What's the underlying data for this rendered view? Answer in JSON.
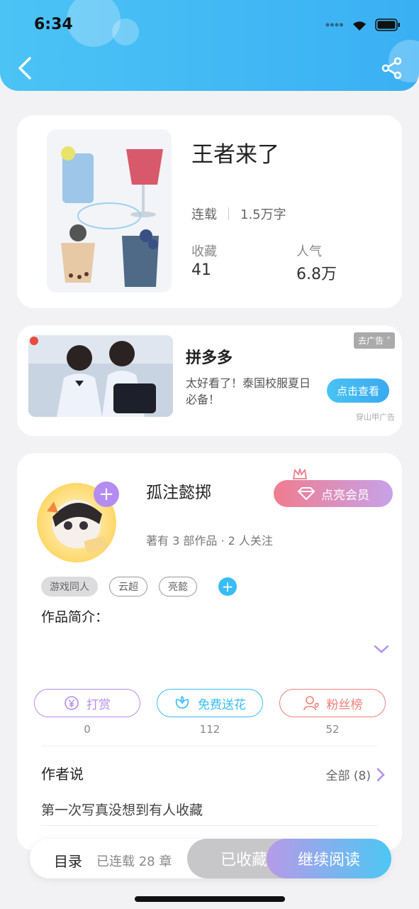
{
  "status_bar": {
    "time": "6:34"
  },
  "book": {
    "title": "王者来了",
    "status": "连载",
    "word_count": "1.5万字",
    "favorites_label": "收藏",
    "favorites_value": "41",
    "popularity_label": "人气",
    "popularity_value": "6.8万"
  },
  "ad": {
    "title": "拼多多",
    "description": "太好看了！泰国校服夏日必备！",
    "button": "点击查看",
    "tag": "去广告",
    "source": "穿山甲广告"
  },
  "author": {
    "name": "孤注懿掷",
    "vip_button": "点亮会员",
    "meta": "著有 3 部作品 · 2 人关注",
    "tags": [
      "游戏同人",
      "云超",
      "亮懿"
    ],
    "intro_label": "作品简介："
  },
  "actions": [
    {
      "label": "打赏",
      "count": "0",
      "color": "#b48cf0"
    },
    {
      "label": "免费送花",
      "count": "112",
      "color": "#38bdf5"
    },
    {
      "label": "粉丝榜",
      "count": "52",
      "color": "#ef7f78"
    }
  ],
  "author_say": {
    "label": "作者说",
    "all": "全部 (8)",
    "text": "第一次写真没想到有人收藏"
  },
  "bottom_bar": {
    "toc": "目录",
    "chapters": "已连载 28 章",
    "collected": "已收藏",
    "continue": "继续阅读"
  }
}
